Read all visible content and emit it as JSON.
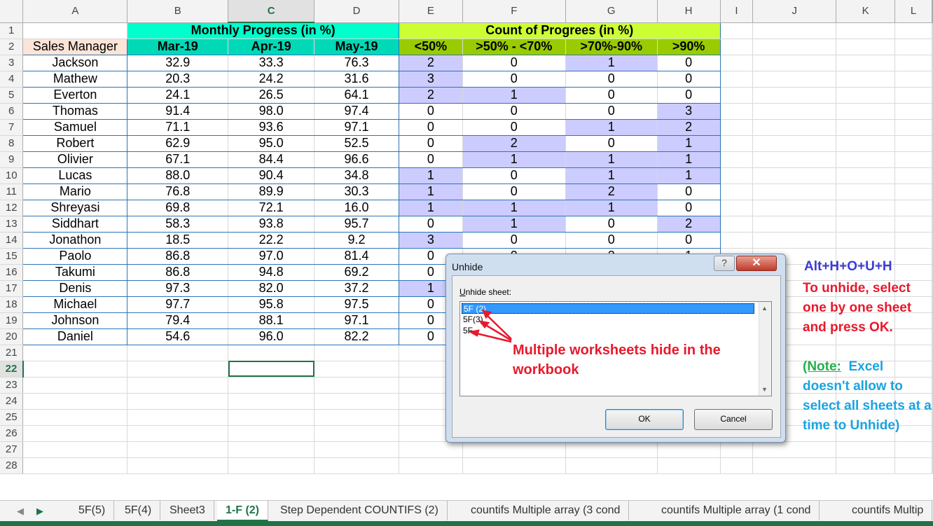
{
  "columns": [
    "A",
    "B",
    "C",
    "D",
    "E",
    "F",
    "G",
    "H",
    "I",
    "J",
    "K",
    "L"
  ],
  "selected_column": "C",
  "selected_row": "22",
  "row_numbers": [
    "1",
    "2",
    "3",
    "4",
    "5",
    "6",
    "7",
    "8",
    "9",
    "10",
    "11",
    "12",
    "13",
    "14",
    "15",
    "16",
    "17",
    "18",
    "19",
    "20",
    "21",
    "22",
    "23",
    "24",
    "25",
    "26",
    "27",
    "28"
  ],
  "header": {
    "monthly_progress": "Monthly Progress (in %)",
    "count_of_progress": "Count of Progrees (in %)",
    "sales_manager": "Sales Manager",
    "months": [
      "Mar-19",
      "Apr-19",
      "May-19"
    ],
    "buckets": [
      "<50%",
      ">50% - <70%",
      ">70%-90%",
      ">90%"
    ]
  },
  "rows": [
    {
      "name": "Jackson",
      "mar": "32.9",
      "apr": "33.3",
      "may": "76.3",
      "counts": [
        "2",
        "0",
        "1",
        "0"
      ]
    },
    {
      "name": "Mathew",
      "mar": "20.3",
      "apr": "24.2",
      "may": "31.6",
      "counts": [
        "3",
        "0",
        "0",
        "0"
      ]
    },
    {
      "name": "Everton",
      "mar": "24.1",
      "apr": "26.5",
      "may": "64.1",
      "counts": [
        "2",
        "1",
        "0",
        "0"
      ]
    },
    {
      "name": "Thomas",
      "mar": "91.4",
      "apr": "98.0",
      "may": "97.4",
      "counts": [
        "0",
        "0",
        "0",
        "3"
      ]
    },
    {
      "name": "Samuel",
      "mar": "71.1",
      "apr": "93.6",
      "may": "97.1",
      "counts": [
        "0",
        "0",
        "1",
        "2"
      ]
    },
    {
      "name": "Robert",
      "mar": "62.9",
      "apr": "95.0",
      "may": "52.5",
      "counts": [
        "0",
        "2",
        "0",
        "1"
      ]
    },
    {
      "name": "Olivier",
      "mar": "67.1",
      "apr": "84.4",
      "may": "96.6",
      "counts": [
        "0",
        "1",
        "1",
        "1"
      ]
    },
    {
      "name": "Lucas",
      "mar": "88.0",
      "apr": "90.4",
      "may": "34.8",
      "counts": [
        "1",
        "0",
        "1",
        "1"
      ]
    },
    {
      "name": "Mario",
      "mar": "76.8",
      "apr": "89.9",
      "may": "30.3",
      "counts": [
        "1",
        "0",
        "2",
        "0"
      ]
    },
    {
      "name": "Shreyasi",
      "mar": "69.8",
      "apr": "72.1",
      "may": "16.0",
      "counts": [
        "1",
        "1",
        "1",
        "0"
      ]
    },
    {
      "name": "Siddhart",
      "mar": "58.3",
      "apr": "93.8",
      "may": "95.7",
      "counts": [
        "0",
        "1",
        "0",
        "2"
      ]
    },
    {
      "name": "Jonathon",
      "mar": "18.5",
      "apr": "22.2",
      "may": "9.2",
      "counts": [
        "3",
        "0",
        "0",
        "0"
      ]
    },
    {
      "name": "Paolo",
      "mar": "86.8",
      "apr": "97.0",
      "may": "81.4",
      "counts": [
        "0",
        "0",
        "2",
        "1"
      ]
    },
    {
      "name": "Takumi",
      "mar": "86.8",
      "apr": "94.8",
      "may": "69.2",
      "counts": [
        "0",
        "",
        "",
        ""
      ]
    },
    {
      "name": "Denis",
      "mar": "97.3",
      "apr": "82.0",
      "may": "37.2",
      "counts": [
        "1",
        "",
        "",
        ""
      ]
    },
    {
      "name": "Michael",
      "mar": "97.7",
      "apr": "95.8",
      "may": "97.5",
      "counts": [
        "0",
        "",
        "",
        ""
      ]
    },
    {
      "name": "Johnson",
      "mar": "79.4",
      "apr": "88.1",
      "may": "97.1",
      "counts": [
        "0",
        "",
        "",
        ""
      ]
    },
    {
      "name": "Daniel",
      "mar": "54.6",
      "apr": "96.0",
      "may": "82.2",
      "counts": [
        "0",
        "",
        "",
        ""
      ]
    }
  ],
  "dialog": {
    "title": "Unhide",
    "label": "Unhide sheet:",
    "items": [
      "5F (2)",
      "5F(3)",
      "5F"
    ],
    "ok": "OK",
    "cancel": "Cancel"
  },
  "annotations": {
    "multi_hidden": "Multiple worksheets hide in the workbook",
    "shortcut": "Alt+H+O+U+H",
    "instruction": "To unhide, select one by one sheet and press OK.",
    "note_label": "(Note:",
    "note_text": "Excel doesn't allow to select all sheets at a time to Unhide)"
  },
  "tabs": [
    "5F(5)",
    "5F(4)",
    "Sheet3",
    "1-F (2)",
    "Step Dependent COUNTIFS (2)",
    "countifs Multiple array (3 cond",
    "countifs Multiple array (1 cond",
    "countifs Multip"
  ],
  "active_tab": "1-F (2)",
  "colors": {
    "monthly_header": "#00ffcc",
    "count_header": "#ccff33",
    "sales_manager_header": "#fce4d6",
    "highlight": "#ccccff",
    "excel_green": "#217346",
    "annotation_red": "#e8192c",
    "annotation_blue": "#3b3bd9",
    "note_cyan": "#1ba3e0"
  }
}
